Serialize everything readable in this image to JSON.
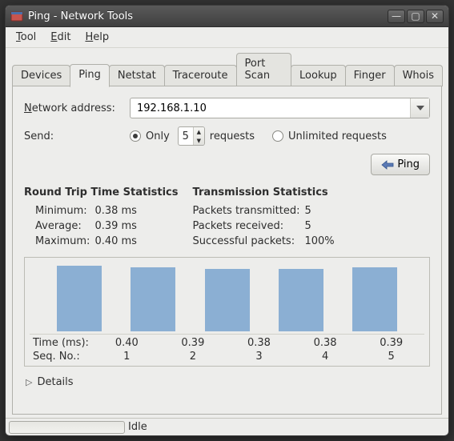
{
  "window": {
    "title": "Ping - Network Tools",
    "buttons": {
      "min": "—",
      "max": "▢",
      "close": "✕"
    }
  },
  "menu": {
    "tool": "Tool",
    "edit": "Edit",
    "help": "Help"
  },
  "tabs": [
    {
      "label": "Devices",
      "active": false
    },
    {
      "label": "Ping",
      "active": true
    },
    {
      "label": "Netstat",
      "active": false
    },
    {
      "label": "Traceroute",
      "active": false
    },
    {
      "label": "Port Scan",
      "active": false
    },
    {
      "label": "Lookup",
      "active": false
    },
    {
      "label": "Finger",
      "active": false
    },
    {
      "label": "Whois",
      "active": false
    }
  ],
  "form": {
    "address_label": "Network address:",
    "address_underline": "N",
    "address_value": "192.168.1.10",
    "send_label": "Send:",
    "only_label": "Only",
    "requests_label": "requests",
    "count_value": "5",
    "unlimited_label": "Unlimited requests",
    "ping_button": "Ping"
  },
  "stats": {
    "rtt_title": "Round Trip Time Statistics",
    "min_k": "Minimum:",
    "min_v": "0.38 ms",
    "avg_k": "Average:",
    "avg_v": "0.39 ms",
    "max_k": "Maximum:",
    "max_v": "0.40 ms",
    "tx_title": "Transmission Statistics",
    "tx_k": "Packets transmitted:",
    "tx_v": "5",
    "rx_k": "Packets received:",
    "rx_v": "5",
    "ok_k": "Successful packets:",
    "ok_v": "100%"
  },
  "chart_data": {
    "type": "bar",
    "title": "",
    "x_label": "Seq. No.:",
    "y_label": "Time (ms):",
    "categories": [
      "1",
      "2",
      "3",
      "4",
      "5"
    ],
    "values": [
      0.4,
      0.39,
      0.38,
      0.38,
      0.39
    ],
    "value_labels": [
      "0.40",
      "0.39",
      "0.38",
      "0.38",
      "0.39"
    ],
    "ylim": [
      0,
      0.4
    ]
  },
  "details_label": "Details",
  "status": {
    "text": "Idle"
  }
}
